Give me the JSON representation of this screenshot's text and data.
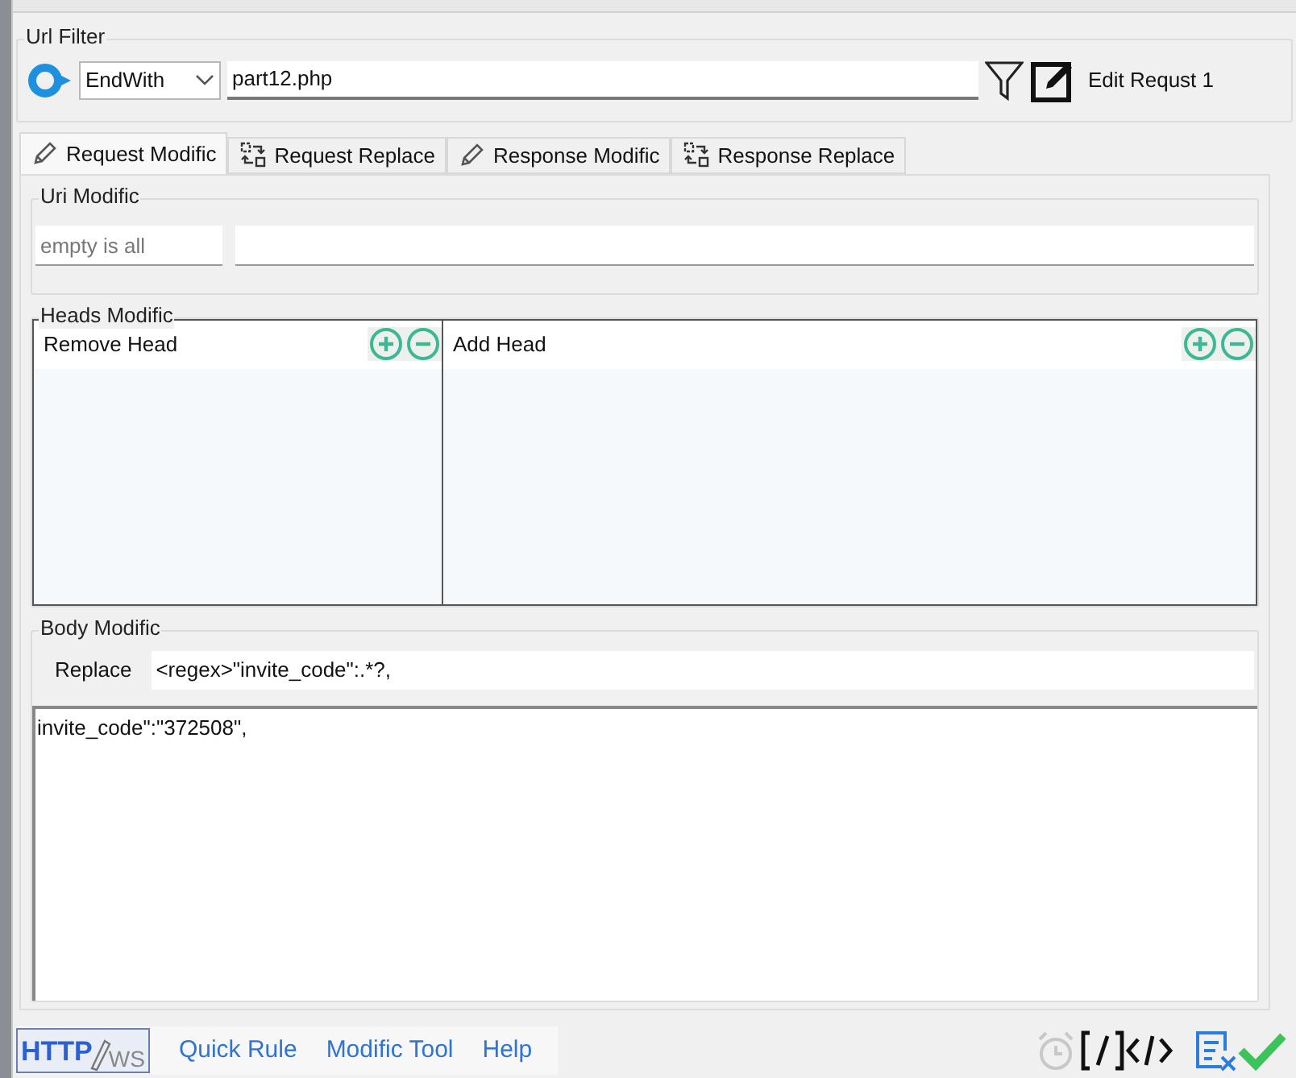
{
  "url_filter": {
    "title": "Url Filter",
    "match_mode": "EndWith",
    "value": "part12.php",
    "rule_label": "Edit Requst 1"
  },
  "tabs": [
    {
      "label": "Request Modific",
      "selected": true,
      "kind": "pencil"
    },
    {
      "label": "Request Replace",
      "selected": false,
      "kind": "replace"
    },
    {
      "label": "Response Modific",
      "selected": false,
      "kind": "pencil"
    },
    {
      "label": "Response Replace",
      "selected": false,
      "kind": "replace"
    }
  ],
  "uri_modific": {
    "title": "Uri Modific",
    "placeholder": "empty is all"
  },
  "heads_modific": {
    "title": "Heads Modific",
    "columns": [
      {
        "header": "Remove Head"
      },
      {
        "header": "Add Head"
      }
    ]
  },
  "body_modific": {
    "title": "Body Modific",
    "replace_label": "Replace",
    "replace_value": "<regex>\"invite_code\":.*?,",
    "body": "invite_code\":\"372508\","
  },
  "footer": {
    "logo_main": "HTTP",
    "logo_sub": "WS",
    "links": [
      "Quick Rule",
      "Modific Tool",
      "Help"
    ]
  }
}
